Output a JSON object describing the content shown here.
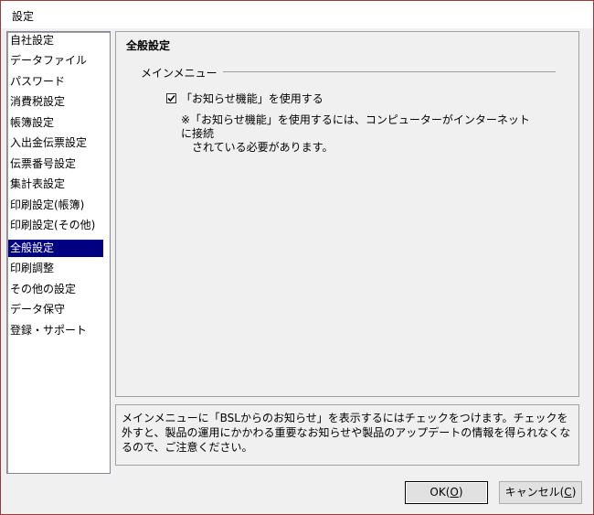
{
  "window": {
    "title": "設定"
  },
  "sidebar": {
    "items": [
      {
        "label": "自社設定",
        "selected": false
      },
      {
        "label": "データファイル",
        "selected": false
      },
      {
        "label": "パスワード",
        "selected": false
      },
      {
        "label": "消費税設定",
        "selected": false
      },
      {
        "label": "帳簿設定",
        "selected": false
      },
      {
        "label": "入出金伝票設定",
        "selected": false
      },
      {
        "label": "伝票番号設定",
        "selected": false
      },
      {
        "label": "集計表設定",
        "selected": false
      },
      {
        "label": "印刷設定(帳簿)",
        "selected": false
      },
      {
        "label": "印刷設定(その他)",
        "selected": false
      },
      {
        "label": "全般設定",
        "selected": true
      },
      {
        "label": "印刷調整",
        "selected": false
      },
      {
        "label": "その他の設定",
        "selected": false
      },
      {
        "label": "データ保守",
        "selected": false
      },
      {
        "label": "登録・サポート",
        "selected": false
      }
    ]
  },
  "main": {
    "group_title": "全般設定",
    "section_label": "メインメニュー",
    "checkbox": {
      "label": "「お知らせ機能」を使用する",
      "checked": true
    },
    "note": "※「お知らせ機能」を使用するには、コンピューターがインターネットに接続\n　されている必要があります。"
  },
  "description": "メインメニューに「BSLからのお知らせ」を表示するにはチェックをつけます。チェックを外すと、製品の運用にかかわる重要なお知らせや製品のアップデートの情報を得られなくなるので、ご注意ください。",
  "buttons": {
    "ok_label": "OK(",
    "ok_key": "O",
    "ok_close": ")",
    "cancel_label": "キャンセル(",
    "cancel_key": "C",
    "cancel_close": ")"
  },
  "colors": {
    "selection": "#000080",
    "frame_border": "#9c3b3b"
  }
}
